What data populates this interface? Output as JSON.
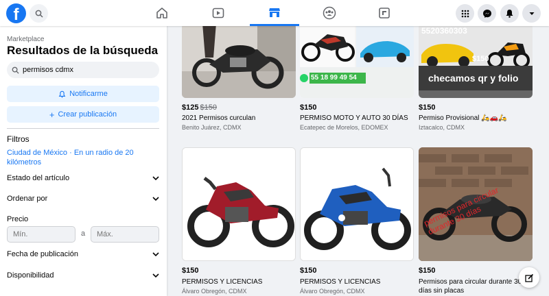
{
  "brand": {
    "logo_letter": "f",
    "color": "#1877f2"
  },
  "header": {
    "nav": [
      {
        "name": "home-icon",
        "active": false
      },
      {
        "name": "watch-icon",
        "active": false
      },
      {
        "name": "marketplace-icon",
        "active": true
      },
      {
        "name": "groups-icon",
        "active": false
      },
      {
        "name": "gaming-icon",
        "active": false
      }
    ],
    "right_icons": [
      "menu-grid-icon",
      "messenger-icon",
      "notifications-icon",
      "account-dropdown-icon"
    ]
  },
  "sidebar": {
    "breadcrumb": "Marketplace",
    "title": "Resultados de la búsqueda",
    "search_value": "permisos cdmx",
    "notify_label": "Notificarme",
    "create_label": "Crear publicación",
    "filters_heading": "Filtros",
    "location": "Ciudad de México · En un radio de 20 kilómetros",
    "state_label": "Estado del artículo",
    "sort_label": "Ordenar por",
    "price_label": "Precio",
    "min_placeholder": "Mín.",
    "max_placeholder": "Máx.",
    "to_label": "a",
    "date_label": "Fecha de publicación",
    "availability_label": "Disponibilidad"
  },
  "listings": [
    {
      "price": "$125",
      "old_price": "$150",
      "title": "2021 Permisos curculan",
      "location": "Benito Juárez, CDMX"
    },
    {
      "price": "$150",
      "old_price": "",
      "title": "PERMISO MOTO Y AUTO 30 DÍAS",
      "location": "Ecatepec de Morelos, EDOMEX",
      "overlay": "55 18 99 49 54"
    },
    {
      "price": "$150",
      "old_price": "",
      "title": "Permiso Provisional 🛵🚗🛵",
      "location": "Iztacalco, CDMX",
      "overlay_price": "$150",
      "overlay_text": "checamos qr y folio",
      "overlay_phone": "5520360303"
    },
    {
      "price": "$150",
      "old_price": "",
      "title": "PERMISOS Y LICENCIAS",
      "location": "Álvaro Obregón, CDMX"
    },
    {
      "price": "$150",
      "old_price": "",
      "title": "PERMISOS Y LICENCIAS",
      "location": "Álvaro Obregón, CDMX"
    },
    {
      "price": "$150",
      "old_price": "",
      "title": "Permisos para circular durante 30 días sin placas",
      "location": "",
      "overlay": "permisos para circular durante 30 días"
    }
  ]
}
